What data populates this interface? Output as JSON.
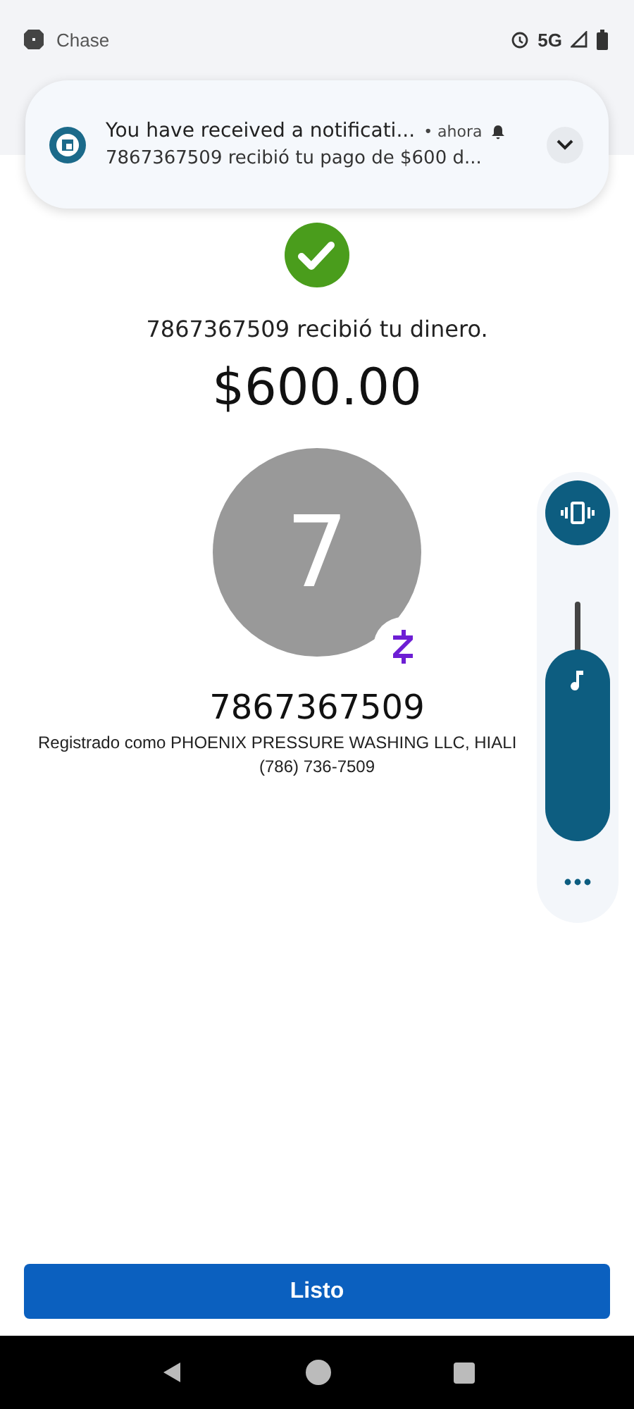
{
  "status_bar": {
    "app": "Chase",
    "network": "5G"
  },
  "notification": {
    "title": "You have received a notificati...",
    "time": "• ahora",
    "body": "7867367509 recibió tu pago de $600 d..."
  },
  "confirmation": {
    "message": "7867367509 recibió tu dinero.",
    "amount": "$600.00"
  },
  "recipient": {
    "initial": "7",
    "name": "7867367509",
    "registered": "Registrado como PHOENIX PRESSURE WASHING LLC, HIALI",
    "phone": "(786) 736-7509"
  },
  "volume_panel": {
    "level": 0.8
  },
  "done_button": "Listo"
}
